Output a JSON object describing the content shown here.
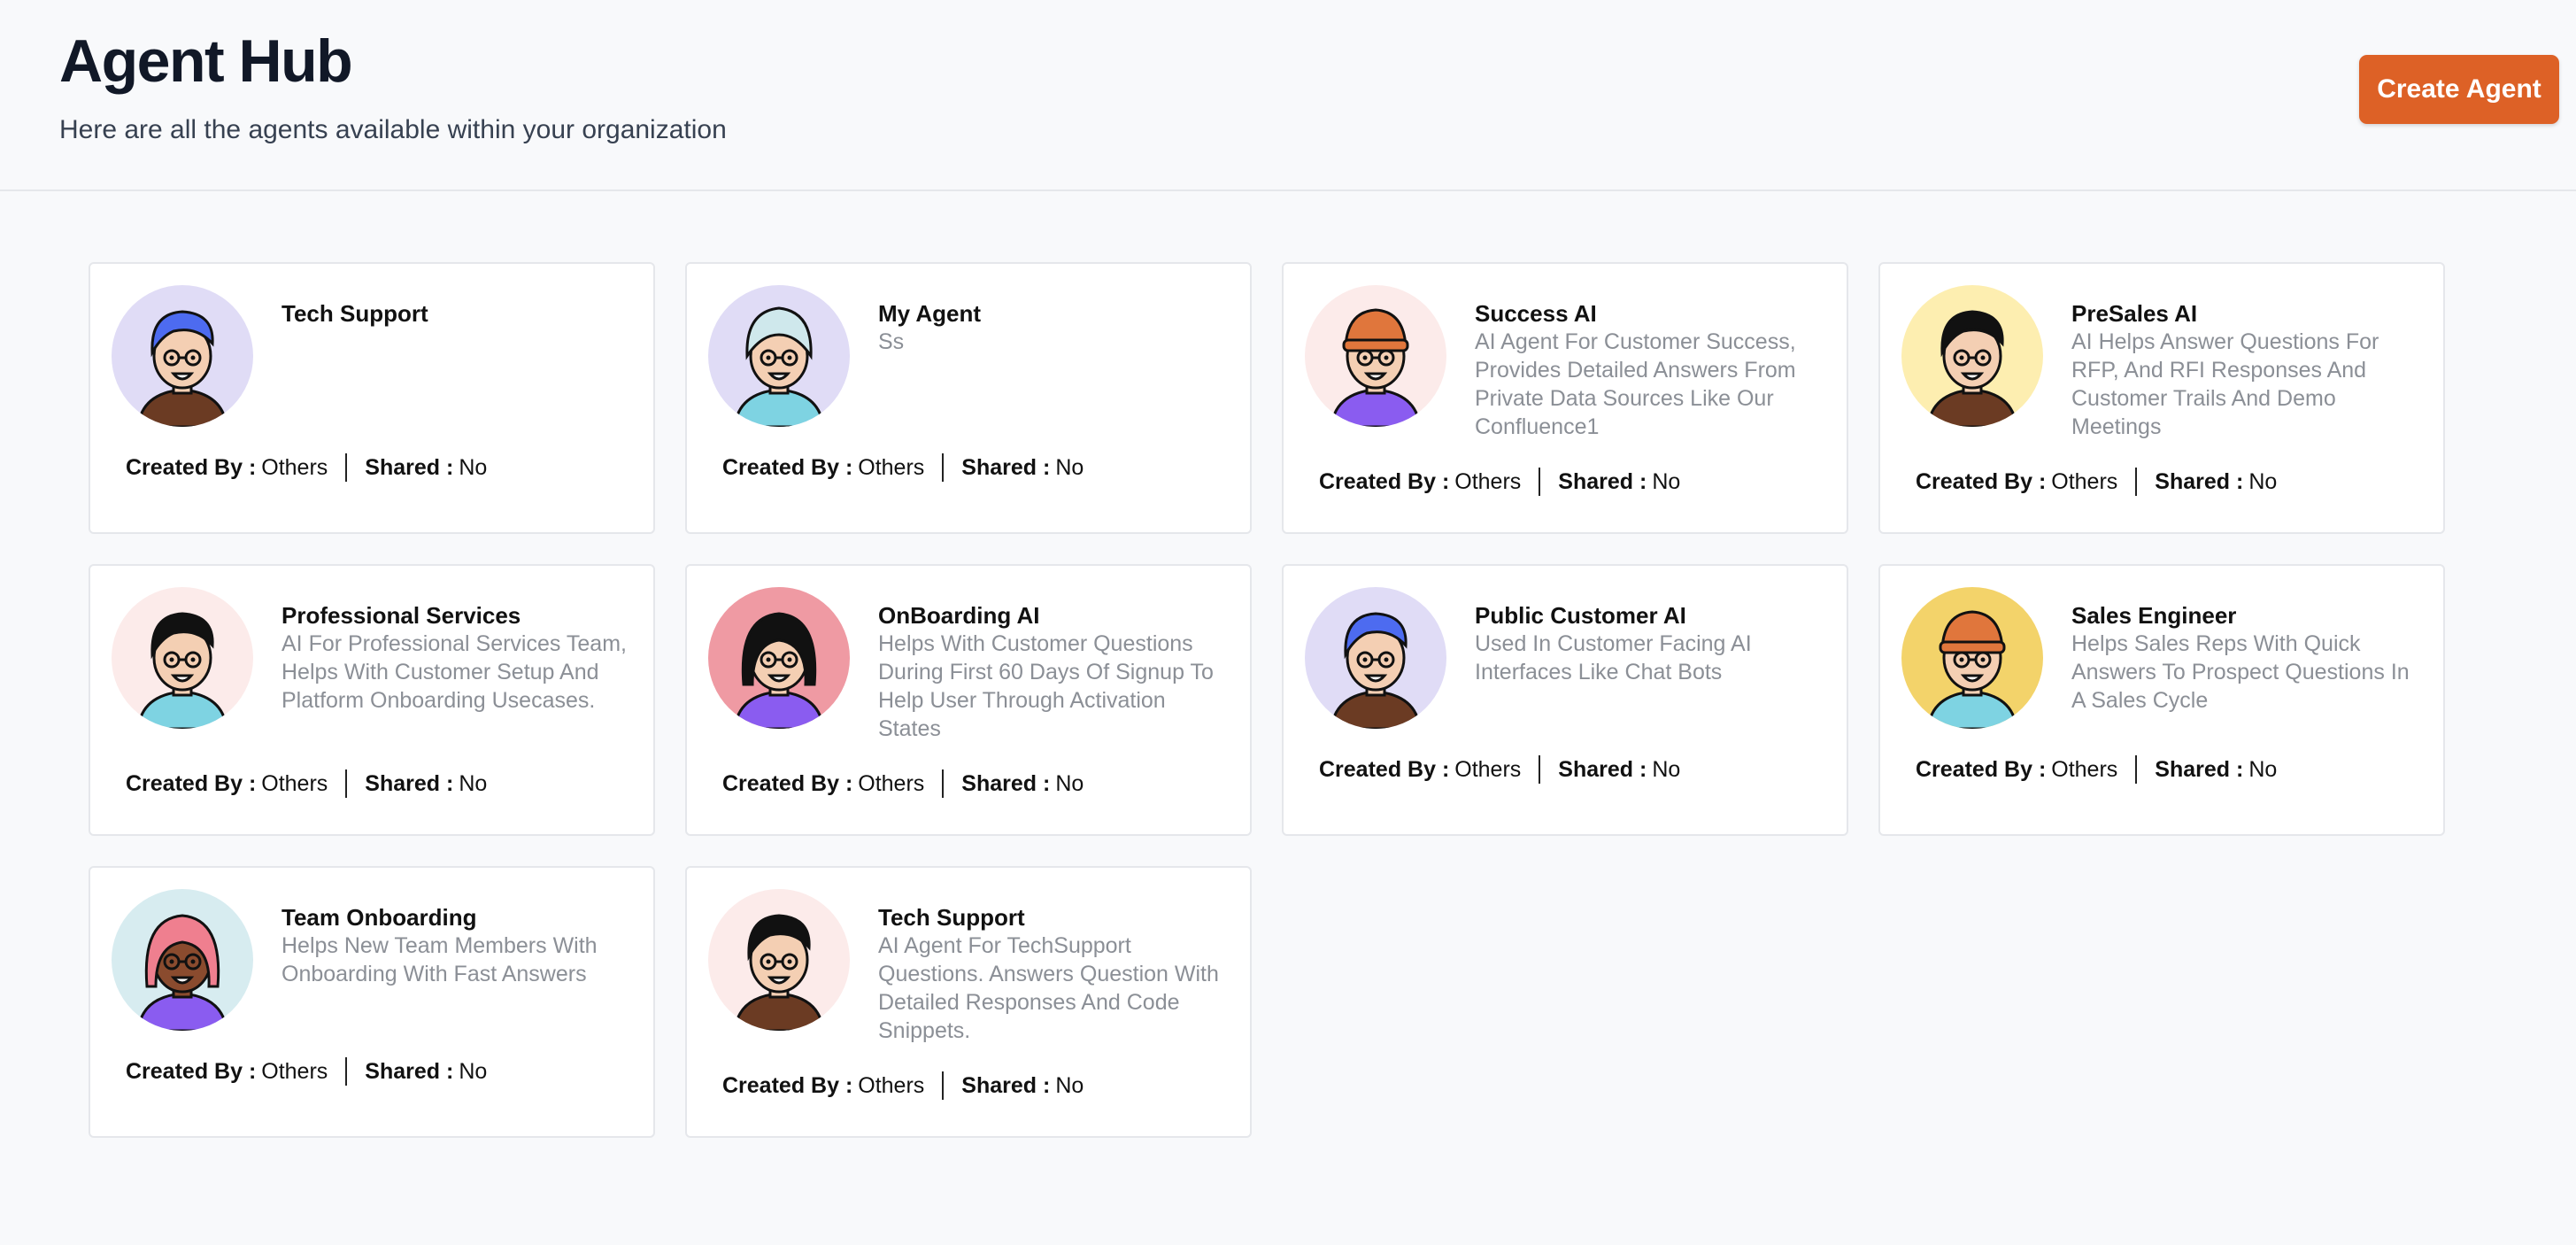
{
  "header": {
    "title": "Agent Hub",
    "subtitle": "Here are all the agents available within your organization",
    "create_button": "Create Agent"
  },
  "footer_labels": {
    "created_by": "Created By :",
    "shared": "Shared :"
  },
  "agents": [
    {
      "name": "Tech Support",
      "description": "",
      "created_by": "Others",
      "shared": "No",
      "avatar": "avatar-blue-hair-icon",
      "bg": "#e0dcf6"
    },
    {
      "name": "My Agent",
      "description": "Ss",
      "created_by": "Others",
      "shared": "No",
      "avatar": "avatar-turban-icon",
      "bg": "#e0dcf6"
    },
    {
      "name": "Success AI",
      "description": "AI Agent For Customer Success, Provides Detailed Answers From Private Data Sources Like Our Confluence1",
      "created_by": "Others",
      "shared": "No",
      "avatar": "avatar-beanie-icon",
      "bg": "#fcebea"
    },
    {
      "name": "PreSales AI",
      "description": "AI Helps Answer Questions For RFP, And RFI Responses And Customer Trails And Demo Meetings",
      "created_by": "Others",
      "shared": "No",
      "avatar": "avatar-black-hair-icon",
      "bg": "#fdeeb0"
    },
    {
      "name": "Professional Services",
      "description": "AI For Professional Services Team, Helps With Customer Setup And Platform Onboarding Usecases.",
      "created_by": "Others",
      "shared": "No",
      "avatar": "avatar-black-hair-icon",
      "bg": "#fcebea"
    },
    {
      "name": "OnBoarding AI",
      "description": "Helps With Customer Questions During First 60 Days Of Signup To Help User Through Activation States",
      "created_by": "Others",
      "shared": "No",
      "avatar": "avatar-bob-hair-icon",
      "bg": "#ef9aa3"
    },
    {
      "name": "Public Customer AI",
      "description": "Used In Customer Facing AI Interfaces Like Chat Bots",
      "created_by": "Others",
      "shared": "No",
      "avatar": "avatar-blue-hair-icon",
      "bg": "#e0dcf6"
    },
    {
      "name": "Sales Engineer",
      "description": "Helps Sales Reps With Quick Answers To Prospect Questions In A Sales Cycle",
      "created_by": "Others",
      "shared": "No",
      "avatar": "avatar-beanie-icon",
      "bg": "#f3d36a"
    },
    {
      "name": "Team Onboarding",
      "description": "Helps New Team Members With Onboarding With Fast Answers",
      "created_by": "Others",
      "shared": "No",
      "avatar": "avatar-pink-hair-icon",
      "bg": "#d7ecf0"
    },
    {
      "name": "Tech Support",
      "description": "AI Agent For TechSupport Questions. Answers Question With Detailed Responses And Code Snippets.",
      "created_by": "Others",
      "shared": "No",
      "avatar": "avatar-black-hair-icon",
      "bg": "#fcebea"
    }
  ]
}
